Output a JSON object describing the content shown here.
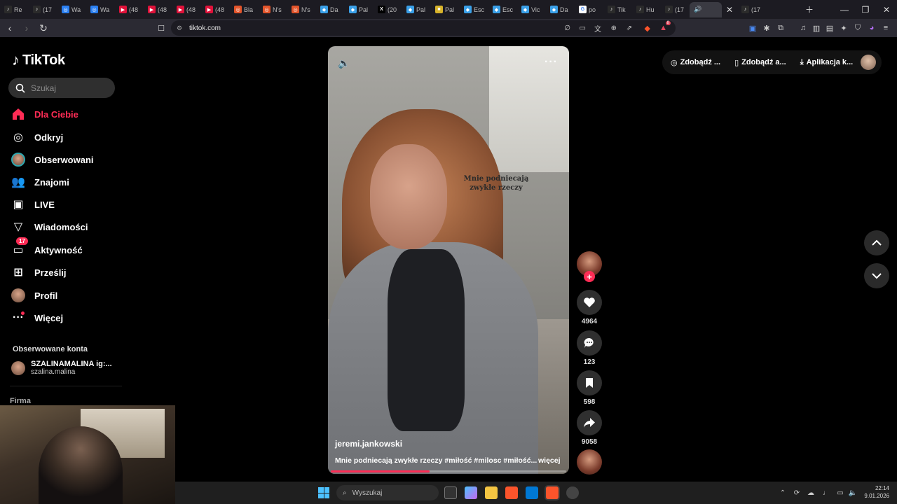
{
  "browser": {
    "tabs": [
      {
        "label": "Re",
        "fav_color": "#2b2b2b",
        "fav": "♪"
      },
      {
        "label": "(17",
        "fav_color": "#2b2b2b",
        "fav": "♪"
      },
      {
        "label": "Wa",
        "fav_color": "#2a7ff0",
        "fav": "◎"
      },
      {
        "label": "Wa",
        "fav_color": "#2a7ff0",
        "fav": "◎"
      },
      {
        "label": "(48",
        "fav_color": "#e0123a",
        "fav": "▶"
      },
      {
        "label": "(48",
        "fav_color": "#e0123a",
        "fav": "▶"
      },
      {
        "label": "(48",
        "fav_color": "#e0123a",
        "fav": "▶"
      },
      {
        "label": "(48",
        "fav_color": "#e0123a",
        "fav": "▶"
      },
      {
        "label": "Bla",
        "fav_color": "#e2542a",
        "fav": "◎"
      },
      {
        "label": "N's",
        "fav_color": "#e2542a",
        "fav": "◎"
      },
      {
        "label": "N's",
        "fav_color": "#e2542a",
        "fav": "◎"
      },
      {
        "label": "Da",
        "fav_color": "#3aa0e8",
        "fav": "◆"
      },
      {
        "label": "Pal",
        "fav_color": "#3aa0e8",
        "fav": "◆"
      },
      {
        "label": "(20",
        "fav_color": "#000000",
        "fav": "X"
      },
      {
        "label": "Pal",
        "fav_color": "#3aa0e8",
        "fav": "◆"
      },
      {
        "label": "Pal",
        "fav_color": "#d7b32a",
        "fav": "■"
      },
      {
        "label": "Esc",
        "fav_color": "#3aa0e8",
        "fav": "◆"
      },
      {
        "label": "Esc",
        "fav_color": "#3aa0e8",
        "fav": "◆"
      },
      {
        "label": "Vic",
        "fav_color": "#3aa0e8",
        "fav": "◆"
      },
      {
        "label": "Da",
        "fav_color": "#3aa0e8",
        "fav": "◆"
      },
      {
        "label": "po",
        "fav_color": "#ffffff",
        "fav": "G"
      },
      {
        "label": "Tik",
        "fav_color": "#2b2b2b",
        "fav": "♪"
      },
      {
        "label": "Hu",
        "fav_color": "#2b2b2b",
        "fav": "♪"
      },
      {
        "label": "(17",
        "fav_color": "#2b2b2b",
        "fav": "♪"
      }
    ],
    "active_tab": {
      "label": "",
      "fav": "🔊"
    },
    "last_tab": {
      "label": "(17",
      "fav": "♪"
    },
    "url": "tiktok.com",
    "brave_badge": "8"
  },
  "sidebar": {
    "logo_text": "TikTok",
    "search_placeholder": "Szukaj",
    "items": [
      {
        "label": "Dla Ciebie",
        "icon": "home-icon"
      },
      {
        "label": "Odkryj",
        "icon": "compass-icon"
      },
      {
        "label": "Obserwowani",
        "icon": "avatar-icon"
      },
      {
        "label": "Znajomi",
        "icon": "friends-icon"
      },
      {
        "label": "LIVE",
        "icon": "live-tv-icon"
      },
      {
        "label": "Wiadomości",
        "icon": "send-icon"
      },
      {
        "label": "Aktywność",
        "icon": "inbox-icon",
        "badge": "17"
      },
      {
        "label": "Prześlij",
        "icon": "upload-plus-icon"
      },
      {
        "label": "Profil",
        "icon": "profile-avatar"
      },
      {
        "label": "Więcej",
        "icon": "more-dots-icon"
      }
    ],
    "followed_heading": "Obserwowane konta",
    "followed": {
      "name": "SZALINAMALINA ig:...",
      "handle": "szalina.malina"
    },
    "company_heading": "Firma"
  },
  "video": {
    "overlay_text_line1": "Mnie podniecają",
    "overlay_text_line2": "zwykłe rzeczy",
    "author": "jeremi.jankowski",
    "description": "Mnie podniecają zwykłe rzeczy #miłość #milosc #miłość...",
    "more_label": "więcej",
    "progress": 0.42
  },
  "actions": {
    "likes": "4964",
    "comments": "123",
    "saves": "598",
    "shares": "9058"
  },
  "top_pill": {
    "item1": "Zdobądź ...",
    "item2": "Zdobądź a...",
    "item3": "Aplikacja k..."
  },
  "taskbar": {
    "search_placeholder": "Wyszukaj",
    "time": "22:14",
    "date": "9.01.2026"
  },
  "colors": {
    "accent": "#fe2c55",
    "background": "#000000",
    "chrome": "#2b2a33"
  }
}
